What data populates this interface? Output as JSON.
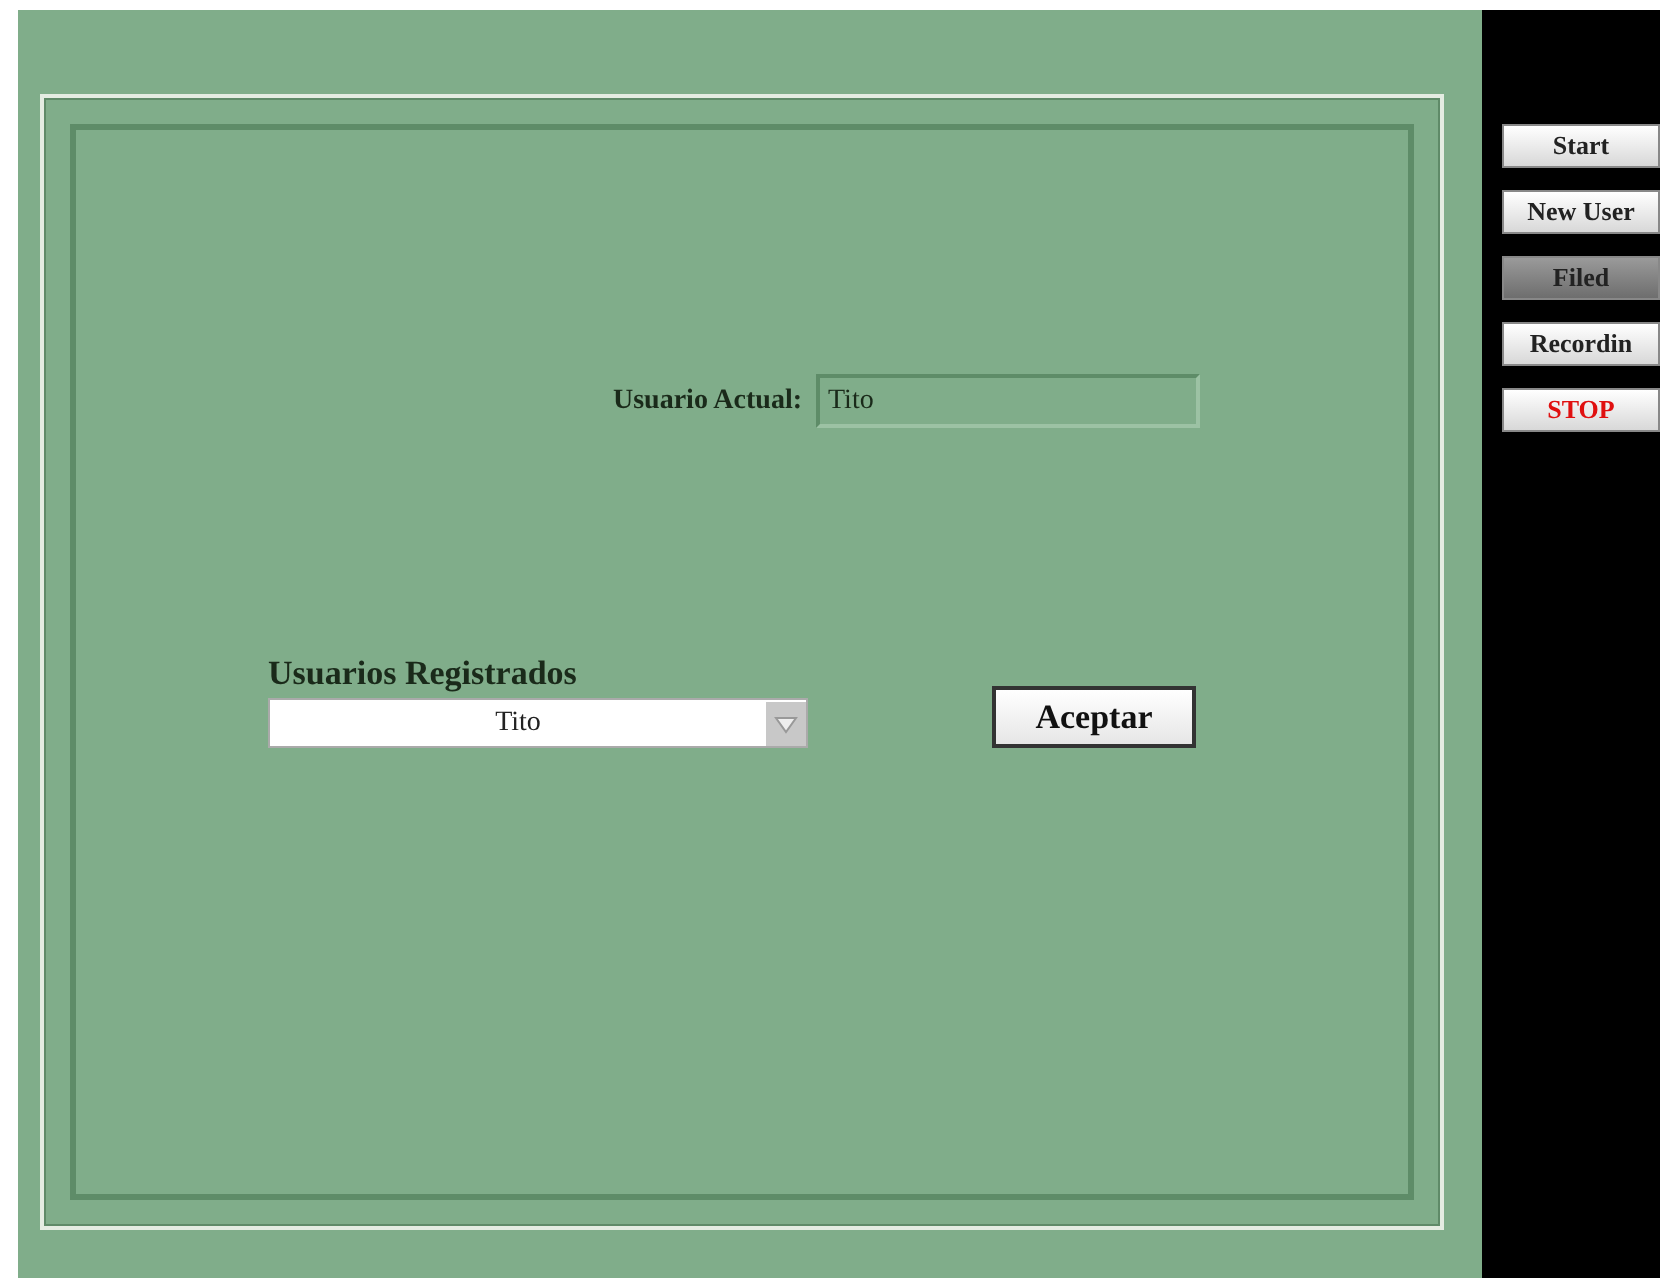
{
  "side_buttons": [
    {
      "label": "Start",
      "selected": false,
      "kind": "normal"
    },
    {
      "label": "New User",
      "selected": false,
      "kind": "normal"
    },
    {
      "label": "Filed",
      "selected": true,
      "kind": "normal"
    },
    {
      "label": "Recordin",
      "selected": false,
      "kind": "normal"
    },
    {
      "label": "STOP",
      "selected": false,
      "kind": "stop"
    }
  ],
  "current_user": {
    "label": "Usuario Actual:",
    "value": "Tito"
  },
  "registered_users": {
    "label": "Usuarios Registrados",
    "value": "Tito"
  },
  "accept_button": {
    "label": "Aceptar"
  }
}
